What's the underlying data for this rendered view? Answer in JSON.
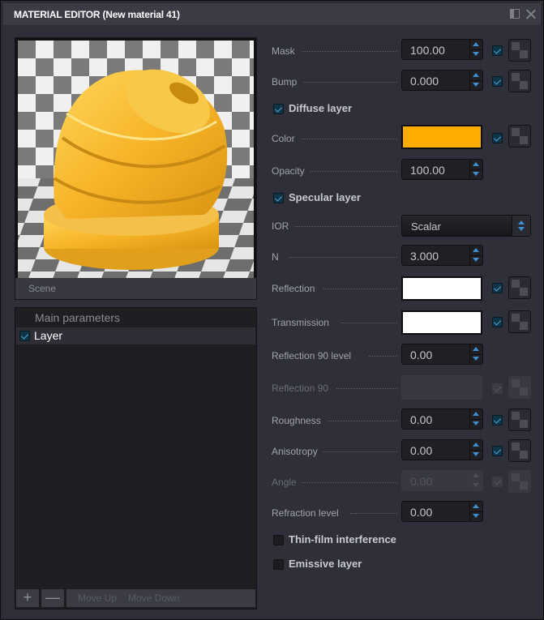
{
  "window": {
    "title": "MATERIAL EDITOR (New material 41)",
    "dock_icon": "dock-icon",
    "close_icon": "close-icon"
  },
  "preview": {
    "label": "Scene",
    "material_color": "#FFB000"
  },
  "layers": {
    "header": "Main parameters",
    "items": [
      {
        "label": "Layer",
        "checked": true
      }
    ],
    "add_label": "+",
    "remove_label": "—",
    "move_up_label": "Move Up",
    "move_down_label": "Move Down"
  },
  "params": {
    "mask": {
      "label": "Mask",
      "value": "100.00",
      "checked": true
    },
    "bump": {
      "label": "Bump",
      "value": "0.000",
      "checked": true
    },
    "diffuse": {
      "label": "Diffuse layer",
      "checked": true
    },
    "color": {
      "label": "Color",
      "color": "#FFAC00",
      "checked": true
    },
    "opacity": {
      "label": "Opacity",
      "value": "100.00"
    },
    "specular": {
      "label": "Specular layer",
      "checked": true
    },
    "ior": {
      "label": "IOR",
      "value": "Scalar"
    },
    "n": {
      "label": "N",
      "value": "3.000"
    },
    "reflection": {
      "label": "Reflection",
      "color": "#FFFFFF",
      "checked": true
    },
    "transmission": {
      "label": "Transmission",
      "color": "#FFFFFF",
      "checked": true
    },
    "reflection90level": {
      "label": "Reflection 90 level",
      "value": "0.00"
    },
    "reflection90": {
      "label": "Reflection 90",
      "disabled": true
    },
    "roughness": {
      "label": "Roughness",
      "value": "0.00",
      "checked": true
    },
    "anisotropy": {
      "label": "Anisotropy",
      "value": "0.00",
      "checked": true
    },
    "angle": {
      "label": "Angle",
      "value": "0.00",
      "disabled": true
    },
    "refraction_level": {
      "label": "Refraction level",
      "value": "0.00"
    },
    "thin_film": {
      "label": "Thin-film interference",
      "checked": false
    },
    "emissive": {
      "label": "Emissive layer",
      "checked": false
    }
  }
}
